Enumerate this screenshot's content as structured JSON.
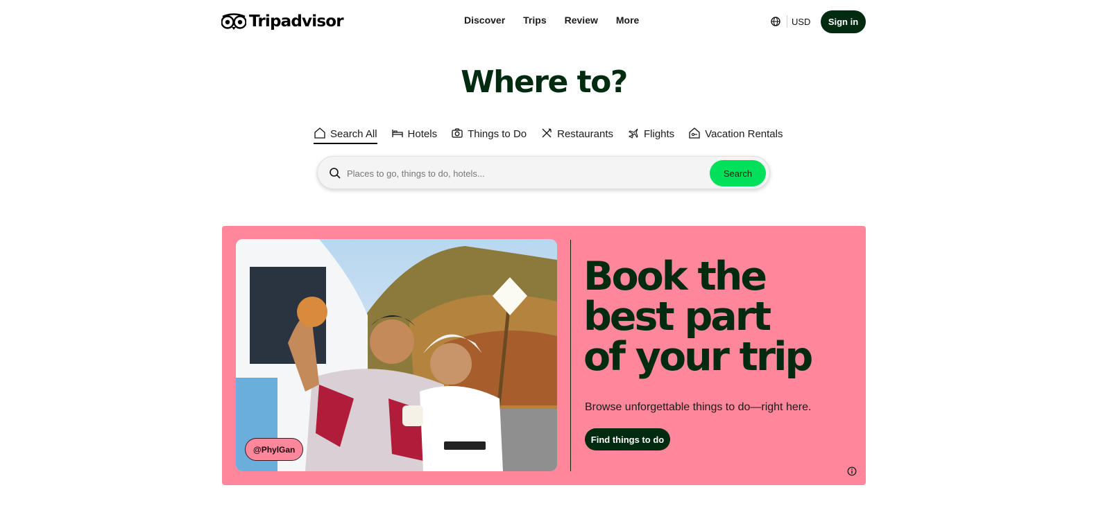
{
  "header": {
    "logo_text": "Tripadvisor",
    "nav": [
      {
        "label": "Discover"
      },
      {
        "label": "Trips"
      },
      {
        "label": "Review"
      },
      {
        "label": "More"
      }
    ],
    "globe_icon": "globe-icon",
    "currency": "USD",
    "signin_label": "Sign in"
  },
  "hero": {
    "title": "Where to?"
  },
  "tabs": [
    {
      "label": "Search All",
      "icon": "home-icon",
      "active": true
    },
    {
      "label": "Hotels",
      "icon": "bed-icon",
      "active": false
    },
    {
      "label": "Things to Do",
      "icon": "camera-icon",
      "active": false
    },
    {
      "label": "Restaurants",
      "icon": "utensils-icon",
      "active": false
    },
    {
      "label": "Flights",
      "icon": "plane-icon",
      "active": false
    },
    {
      "label": "Vacation Rentals",
      "icon": "house-key-icon",
      "active": false
    }
  ],
  "search": {
    "placeholder": "Places to go, things to do, hotels...",
    "value": "",
    "button_label": "Search",
    "accent": "#00e05a"
  },
  "promo": {
    "background": "#ff879c",
    "photo_credit": "@PhylGan",
    "headline_lines": [
      "Book the",
      "best part",
      "of your trip"
    ],
    "subtitle": "Browse unforgettable things to do—right here.",
    "cta_label": "Find things to do",
    "info_icon": "info-icon"
  },
  "colors": {
    "brand_dark": "#002b11",
    "brand_green": "#00e05a",
    "promo_pink": "#ff879c"
  }
}
